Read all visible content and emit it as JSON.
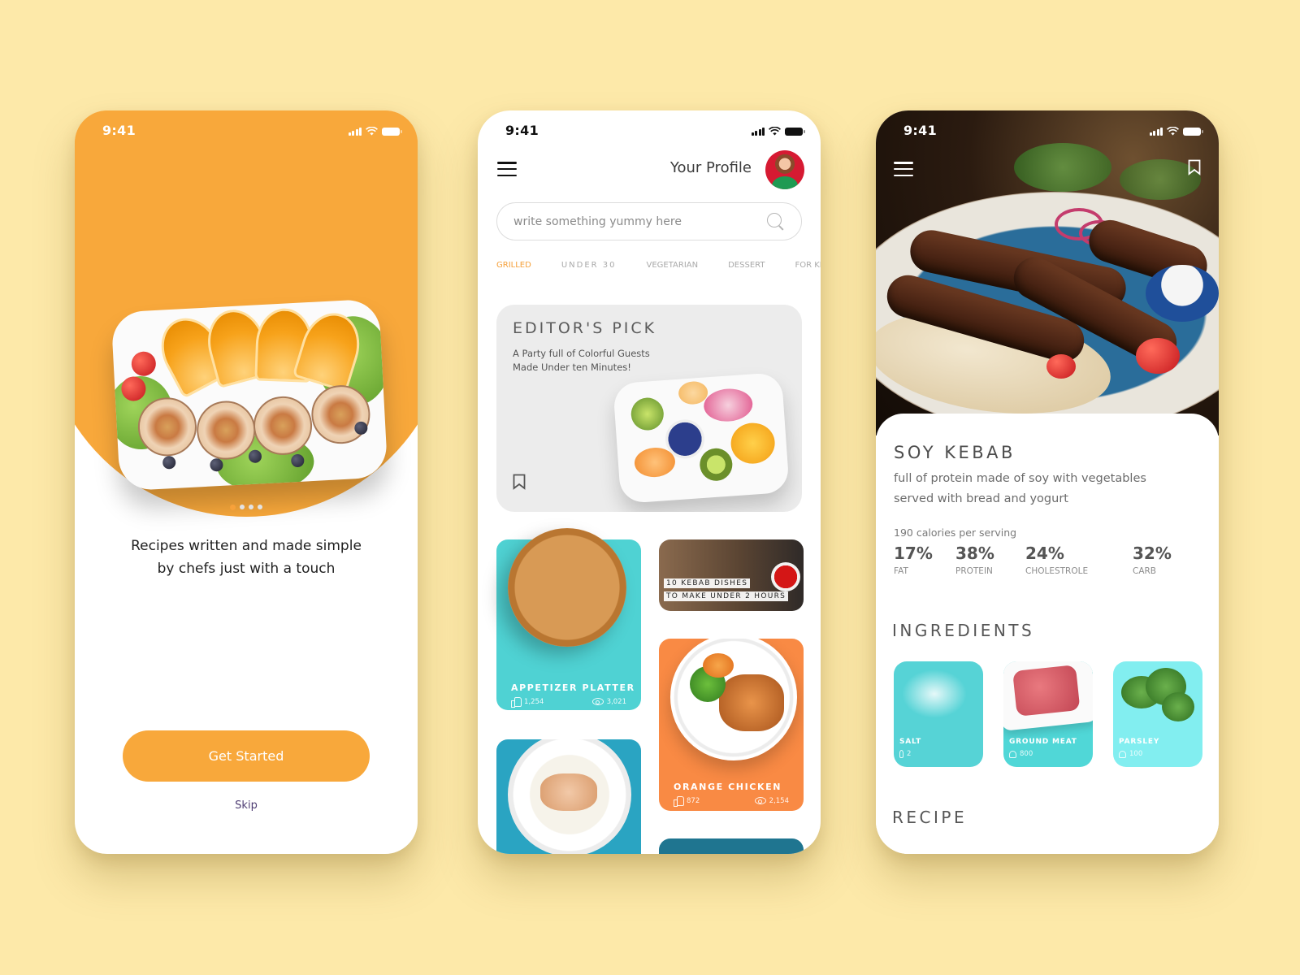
{
  "status_bar": {
    "time": "9:41"
  },
  "onboarding": {
    "tagline_line1": "Recipes written and made simple",
    "tagline_line2": "by chefs just with a touch",
    "pager": {
      "total": 4,
      "active_index": 0
    },
    "get_started_label": "Get Started",
    "skip_label": "Skip",
    "accent_color": "#f8a83b"
  },
  "home": {
    "profile_label": "Your Profile",
    "search": {
      "placeholder": "write something yummy here",
      "value": ""
    },
    "tabs": [
      {
        "label": "GRILLED",
        "active": true
      },
      {
        "label": "UNDER 30",
        "active": false
      },
      {
        "label": "VEGETARIAN",
        "active": false
      },
      {
        "label": "DESSERT",
        "active": false
      },
      {
        "label": "FOR KIDS",
        "active": false
      }
    ],
    "editors_pick": {
      "title": "EDITOR'S PICK",
      "subtitle_line1": "A Party full of Colorful Guests",
      "subtitle_line2": "Made Under ten Minutes!"
    },
    "cards": {
      "appetizer": {
        "title": "APPETIZER PLATTER",
        "likes": "1,254",
        "views": "3,021",
        "color": "#4fd2d3"
      },
      "kebab": {
        "line1": "10 KEBAB DISHES",
        "line2": "TO MAKE UNDER 2 HOURS"
      },
      "orange_chicken": {
        "title": "ORANGE CHICKEN",
        "likes": "872",
        "views": "2,154",
        "color": "#f98a44"
      }
    }
  },
  "recipe": {
    "name": "SOY KEBAB",
    "description_line1": "full of protein made of soy with vegetables",
    "description_line2": "served with bread and yogurt",
    "calories": "190 calories per serving",
    "nutrition": [
      {
        "value": "17%",
        "label": "FAT"
      },
      {
        "value": "38%",
        "label": "PROTEIN"
      },
      {
        "value": "24%",
        "label": "CHOLESTROLE"
      },
      {
        "value": "32%",
        "label": "CARB"
      }
    ],
    "ingredients_title": "INGREDIENTS",
    "ingredients": [
      {
        "name": "SALT",
        "qty": "2"
      },
      {
        "name": "GROUND MEAT",
        "qty": "800"
      },
      {
        "name": "PARSLEY",
        "qty": "100"
      }
    ],
    "recipe_title": "RECIPE"
  }
}
